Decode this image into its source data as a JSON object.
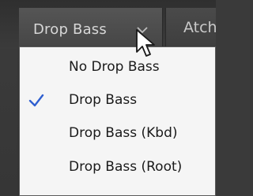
{
  "dropdown": {
    "selected_label": "Drop Bass",
    "chevron_icon": "chevron-down-icon"
  },
  "next_tab": {
    "label": "Atch"
  },
  "menu": {
    "items": [
      {
        "label": "No Drop Bass",
        "checked": false
      },
      {
        "label": "Drop Bass",
        "checked": true
      },
      {
        "label": "Drop Bass (Kbd)",
        "checked": false
      },
      {
        "label": "Drop Bass (Root)",
        "checked": false
      }
    ],
    "check_icon": "checkmark-icon",
    "check_color": "#2f5fd0"
  },
  "cursor_icon": "mouse-pointer-icon"
}
